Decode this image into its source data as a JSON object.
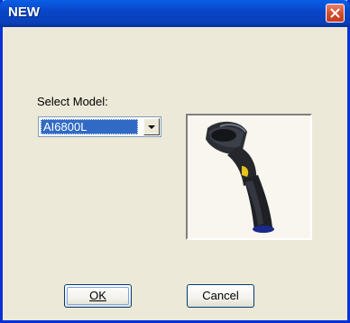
{
  "window": {
    "title": "NEW"
  },
  "select_model": {
    "label": "Select Model:",
    "selected": "AI6800L"
  },
  "preview": {
    "icon": "barcode-scanner-image"
  },
  "buttons": {
    "ok_label": "OK",
    "cancel_label": "Cancel"
  },
  "colors": {
    "titlebar": "#0846c8",
    "close_button": "#d14c2c",
    "dialog_bg": "#ece9d8",
    "selection": "#316ac5"
  }
}
